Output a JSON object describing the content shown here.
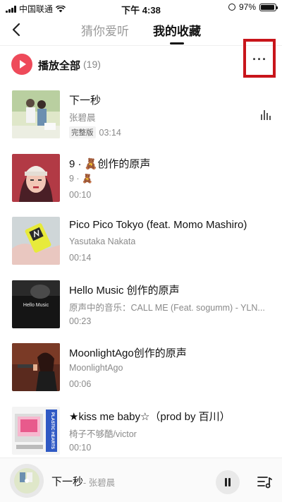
{
  "status_bar": {
    "carrier": "中国联通",
    "time": "下午 4:38",
    "battery": "97%",
    "battery_level": 0.97
  },
  "nav": {
    "tabs": [
      {
        "label": "猜你爱听"
      },
      {
        "label": "我的收藏"
      }
    ]
  },
  "play_all": {
    "label": "播放全部",
    "count": "(19)",
    "more_label": "···"
  },
  "songs": [
    {
      "title": "下一秒",
      "artist": "张碧晨",
      "tag": "完整版",
      "duration": "03:14"
    },
    {
      "title": "9 · 🧸创作的原声",
      "artist": "9 · 🧸",
      "duration": "00:10"
    },
    {
      "title": "Pico Pico Tokyo (feat. Momo Mashiro)",
      "artist": "Yasutaka Nakata",
      "duration": "00:14"
    },
    {
      "title": "Hello Music 创作的原声",
      "artist": "原声中的音乐：CALL ME (Feat. sogumm) - YLN...",
      "duration": "00:23"
    },
    {
      "title": "MoonlightAgo创作的原声",
      "artist": "MoonlightAgo",
      "duration": "00:06"
    },
    {
      "title": "★kiss me baby☆（prod by 百川）",
      "artist": "椅子不够酷/victor",
      "duration": "00:10"
    }
  ],
  "player": {
    "title": "下一秒",
    "artist": "- 张碧晨"
  },
  "colors": {
    "accent": "#ee4a5a",
    "highlight_box": "#c8151b"
  }
}
